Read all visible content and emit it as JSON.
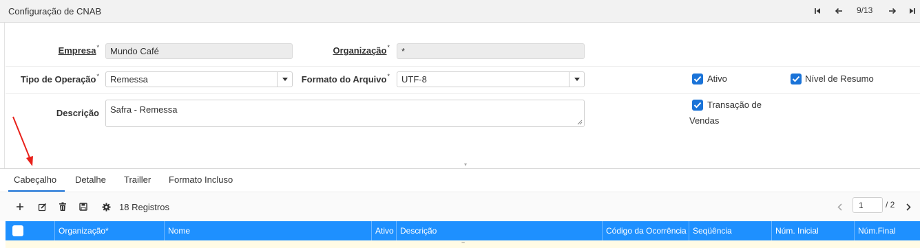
{
  "window": {
    "title": "Configuração de CNAB",
    "record_position": "9/13"
  },
  "form": {
    "empresa": {
      "label": "Empresa",
      "value": "Mundo Café"
    },
    "organizacao": {
      "label": "Organização",
      "value": "*"
    },
    "tipo_operacao": {
      "label": "Tipo de Operação",
      "value": "Remessa"
    },
    "formato_arquivo": {
      "label": "Formato do Arquivo",
      "value": "UTF-8"
    },
    "descricao": {
      "label": "Descrição",
      "value": "Safra - Remessa"
    },
    "required_mark": "*",
    "checkboxes": {
      "ativo": {
        "label": "Ativo",
        "checked": true
      },
      "nivel_resumo": {
        "label": "Nível de Resumo",
        "checked": true
      },
      "transacao_vendas": {
        "label_line1": "Transação de",
        "label_line2": "Vendas",
        "checked": true
      }
    }
  },
  "tabs": [
    "Cabeçalho",
    "Detalhe",
    "Trailler",
    "Formato Incluso"
  ],
  "active_tab": "Cabeçalho",
  "toolbar": {
    "icons": [
      "plus-icon",
      "edit-icon",
      "trash-icon",
      "save-icon",
      "gear-icon"
    ],
    "records_label": "18 Registros",
    "page_current": "1",
    "page_total": "/ 2"
  },
  "grid": {
    "columns": [
      "Organização*",
      "Nome",
      "Ativo",
      "Descrição",
      "Código da Ocorrência",
      "Seqüência",
      "Núm. Inicial",
      "Núm.Final"
    ],
    "row_mark": "~"
  },
  "colors": {
    "accent": "#1a73d8",
    "grid_header": "#1e90ff",
    "annotation_arrow": "#e8201a",
    "row_highlight": "#fffbe5"
  }
}
